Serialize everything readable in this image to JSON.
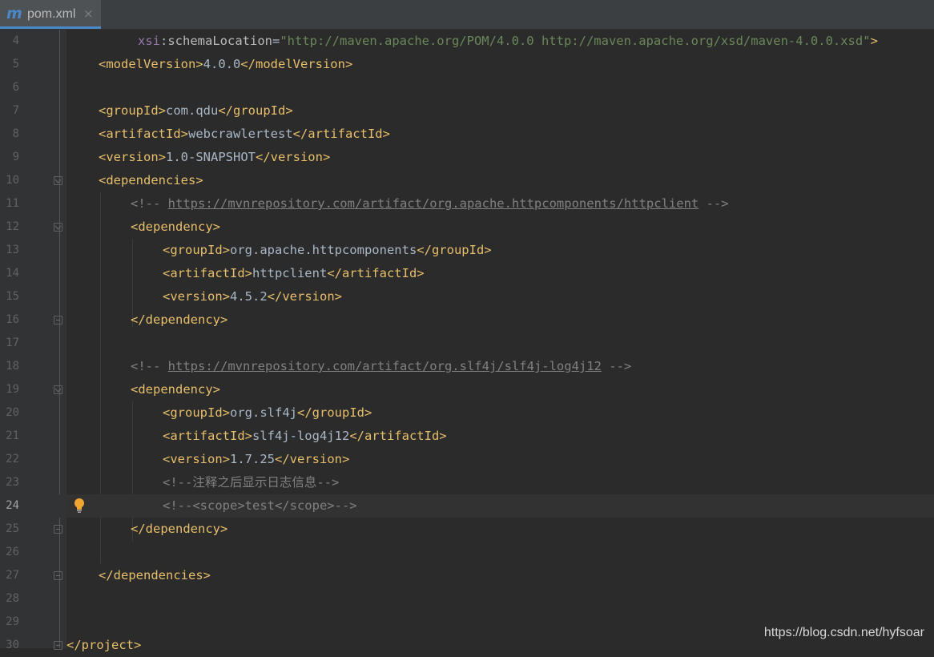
{
  "tab": {
    "icon": "m",
    "label": "pom.xml",
    "close": "×"
  },
  "lines": [
    {
      "n": "4",
      "indent": 0,
      "content": "schema"
    },
    {
      "n": "5",
      "content": "modelVersion"
    },
    {
      "n": "6"
    },
    {
      "n": "7",
      "content": "groupId"
    },
    {
      "n": "8",
      "content": "artifactId"
    },
    {
      "n": "9",
      "content": "version"
    },
    {
      "n": "10",
      "content": "dependencies-open"
    },
    {
      "n": "11",
      "content": "comment1"
    },
    {
      "n": "12",
      "content": "dep1-open"
    },
    {
      "n": "13"
    },
    {
      "n": "14"
    },
    {
      "n": "15"
    },
    {
      "n": "16"
    },
    {
      "n": "17"
    },
    {
      "n": "18"
    },
    {
      "n": "19"
    },
    {
      "n": "20"
    },
    {
      "n": "21"
    },
    {
      "n": "22"
    },
    {
      "n": "23"
    },
    {
      "n": "24"
    },
    {
      "n": "25"
    },
    {
      "n": "26"
    },
    {
      "n": "27"
    },
    {
      "n": "28"
    },
    {
      "n": "29"
    },
    {
      "n": "30"
    }
  ],
  "code": {
    "l4": {
      "ns": "xsi",
      "colon": ":",
      "attr": "schemaLocation",
      "eq": "=",
      "value": "\"http://maven.apache.org/POM/4.0.0 http://maven.apache.org/xsd/maven-4.0.0.xsd\"",
      "close": ">"
    },
    "l5": {
      "open": "<modelVersion>",
      "text": "4.0.0",
      "close": "</modelVersion>"
    },
    "l7": {
      "open": "<groupId>",
      "text": "com.qdu",
      "close": "</groupId>"
    },
    "l8": {
      "open": "<artifactId>",
      "text": "webcrawlertest",
      "close": "</artifactId>"
    },
    "l9": {
      "open": "<version>",
      "text": "1.0-SNAPSHOT",
      "close": "</version>"
    },
    "l10": {
      "open": "<dependencies>"
    },
    "l11": {
      "start": "<!-- ",
      "link": "https://mvnrepository.com/artifact/org.apache.httpcomponents/httpclient",
      "end": " -->"
    },
    "l12": {
      "open": "<dependency>"
    },
    "l13": {
      "open": "<groupId>",
      "text": "org.apache.httpcomponents",
      "close": "</groupId>"
    },
    "l14": {
      "open": "<artifactId>",
      "text": "httpclient",
      "close": "</artifactId>"
    },
    "l15": {
      "open": "<version>",
      "text": "4.5.2",
      "close": "</version>"
    },
    "l16": {
      "close": "</dependency>"
    },
    "l18": {
      "start": "<!-- ",
      "link": "https://mvnrepository.com/artifact/org.slf4j/slf4j-log4j12",
      "end": " -->"
    },
    "l19": {
      "open": "<dependency>"
    },
    "l20": {
      "open": "<groupId>",
      "text": "org.slf4j",
      "close": "</groupId>"
    },
    "l21": {
      "open": "<artifactId>",
      "text": "slf4j-log4j12",
      "close": "</artifactId>"
    },
    "l22": {
      "open": "<version>",
      "text": "1.7.25",
      "close": "</version>"
    },
    "l23": {
      "comment": "<!--注释之后显示日志信息-->"
    },
    "l24": {
      "comment": "<!--<scope>test</scope>-->"
    },
    "l25": {
      "close": "</dependency>"
    },
    "l27": {
      "close": "</dependencies>"
    },
    "l30": {
      "close": "</project>"
    }
  },
  "watermark": "https://blog.csdn.net/hyfsoar",
  "colors": {
    "background": "#2b2b2b",
    "gutter": "#313335",
    "tag": "#e8bf6a",
    "text": "#a9b7c6",
    "string": "#6a8759",
    "comment": "#808080",
    "namespace": "#9876aa",
    "tab_accent": "#4a88c7",
    "current_line": "#323232"
  },
  "icons": {
    "tab": "maven-m-icon",
    "fold": "fold-marker-icon",
    "intention": "lightbulb-icon"
  }
}
